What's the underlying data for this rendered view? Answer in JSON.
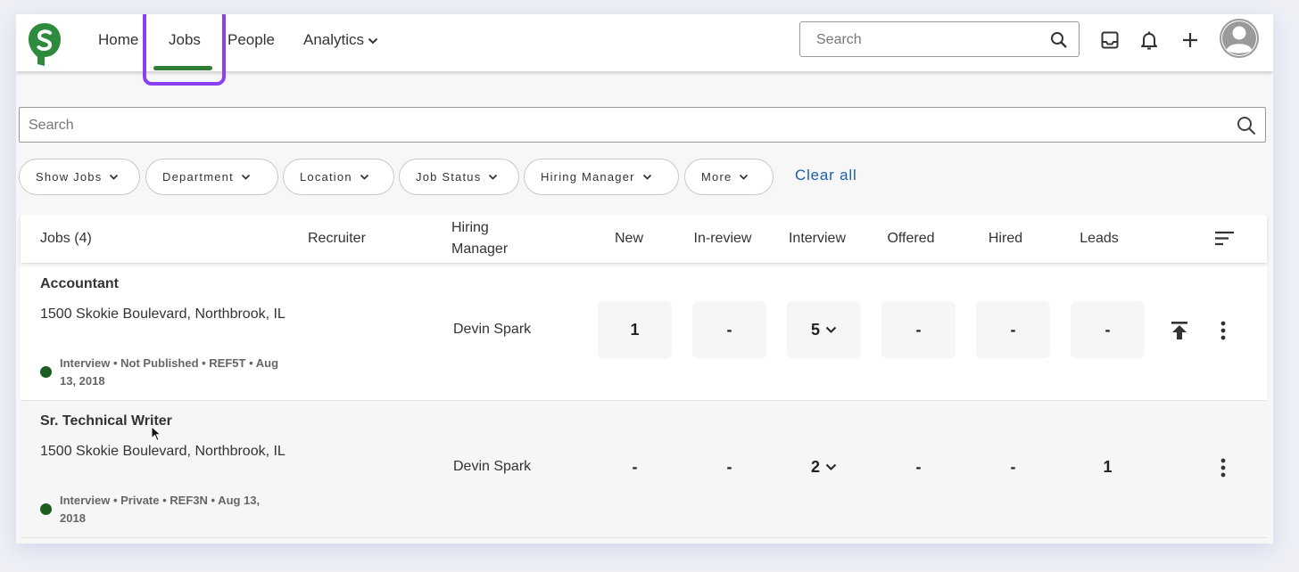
{
  "nav": {
    "home": "Home",
    "jobs": "Jobs",
    "people": "People",
    "analytics": "Analytics"
  },
  "top_search": {
    "placeholder": "Search"
  },
  "main_search": {
    "placeholder": "Search"
  },
  "filters": {
    "show_jobs": "Show Jobs",
    "department": "Department",
    "location": "Location",
    "job_status": "Job Status",
    "hiring_manager": "Hiring Manager",
    "more": "More",
    "clear_all": "Clear all"
  },
  "table": {
    "headers": {
      "jobs": "Jobs (4)",
      "recruiter": "Recruiter",
      "hiring_manager": "Hiring Manager",
      "new": "New",
      "in_review": "In-review",
      "interview": "Interview",
      "offered": "Offered",
      "hired": "Hired",
      "leads": "Leads"
    },
    "rows": [
      {
        "title": "Accountant",
        "location": "1500 Skokie Boulevard, Northbrook, IL",
        "meta": "Interview • Not Published • REF5T • Aug 13, 2018",
        "hiring_manager": "Devin Spark",
        "new": "1",
        "in_review": "-",
        "interview": "5",
        "offered": "-",
        "hired": "-",
        "leads": "-"
      },
      {
        "title": "Sr. Technical Writer",
        "location": "1500 Skokie Boulevard, Northbrook, IL",
        "meta": "Interview • Private • REF3N • Aug 13, 2018",
        "hiring_manager": "Devin Spark",
        "new": "-",
        "in_review": "-",
        "interview": "2",
        "offered": "-",
        "hired": "-",
        "leads": "1"
      }
    ]
  },
  "colors": {
    "brand_green": "#2e8b3e",
    "active_underline": "#2e7d32",
    "highlight_purple": "#8a3ff0",
    "link_blue": "#1d5fa8",
    "status_dot": "#1b5e20"
  },
  "icons": {
    "logo": "smartrecruiters-logo",
    "search": "search-icon",
    "inbox": "inbox-icon",
    "bell": "bell-icon",
    "plus": "plus-icon",
    "avatar": "avatar-icon",
    "sort": "sort-icon",
    "publish": "publish-icon",
    "kebab": "kebab-menu-icon",
    "chevron": "chevron-down-icon"
  }
}
